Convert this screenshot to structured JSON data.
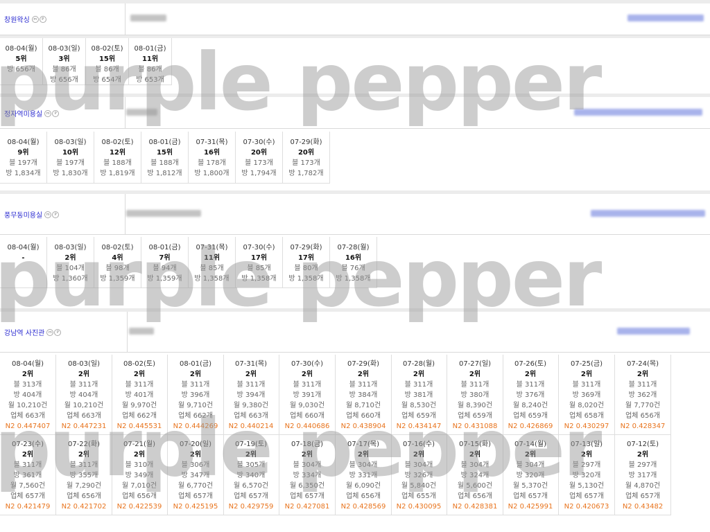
{
  "sections": [
    {
      "name": "창원왁싱",
      "columns": [
        {
          "date": "08-04(월)",
          "rank": "5위",
          "lines": [
            "방 656개"
          ]
        },
        {
          "date": "08-03(일)",
          "rank": "3위",
          "lines": [
            "블 86개",
            "방 656개"
          ]
        },
        {
          "date": "08-02(토)",
          "rank": "15위",
          "lines": [
            "블 86개",
            "방 654개"
          ]
        },
        {
          "date": "08-01(금)",
          "rank": "11위",
          "lines": [
            "블 86개",
            "방 653개"
          ]
        }
      ]
    },
    {
      "name": "정자역미용실",
      "columns": [
        {
          "date": "08-04(월)",
          "rank": "9위",
          "lines": [
            "블 197개",
            "방 1,834개"
          ]
        },
        {
          "date": "08-03(일)",
          "rank": "10위",
          "lines": [
            "블 197개",
            "방 1,830개"
          ]
        },
        {
          "date": "08-02(토)",
          "rank": "12위",
          "lines": [
            "블 188개",
            "방 1,819개"
          ]
        },
        {
          "date": "08-01(금)",
          "rank": "15위",
          "lines": [
            "블 188개",
            "방 1,812개"
          ]
        },
        {
          "date": "07-31(목)",
          "rank": "16위",
          "lines": [
            "블 178개",
            "방 1,800개"
          ]
        },
        {
          "date": "07-30(수)",
          "rank": "20위",
          "lines": [
            "블 173개",
            "방 1,794개"
          ]
        },
        {
          "date": "07-29(화)",
          "rank": "20위",
          "lines": [
            "블 173개",
            "방 1,782개"
          ]
        }
      ]
    },
    {
      "name": "풍무동미용실",
      "columns": [
        {
          "date": "08-04(월)",
          "rank": "-",
          "lines": []
        },
        {
          "date": "08-03(일)",
          "rank": "2위",
          "lines": [
            "블 104개",
            "방 1,360개"
          ]
        },
        {
          "date": "08-02(토)",
          "rank": "4위",
          "lines": [
            "블 98개",
            "방 1,359개"
          ]
        },
        {
          "date": "08-01(금)",
          "rank": "7위",
          "lines": [
            "블 94개",
            "방 1,359개"
          ]
        },
        {
          "date": "07-31(목)",
          "rank": "11위",
          "lines": [
            "블 85개",
            "방 1,358개"
          ]
        },
        {
          "date": "07-30(수)",
          "rank": "17위",
          "lines": [
            "블 85개",
            "방 1,358개"
          ]
        },
        {
          "date": "07-29(화)",
          "rank": "17위",
          "lines": [
            "블 80개",
            "방 1,358개"
          ]
        },
        {
          "date": "07-28(월)",
          "rank": "16위",
          "lines": [
            "블 76개",
            "방 1,358개"
          ]
        }
      ]
    },
    {
      "name": "강남역 사진관",
      "columns": [
        {
          "date": "08-04(월)",
          "rank": "2위",
          "lines": [
            "블 313개",
            "방 404개",
            "월 10,210건",
            "업체 663개"
          ],
          "n2": "N2 0.447407"
        },
        {
          "date": "08-03(일)",
          "rank": "2위",
          "lines": [
            "블 311개",
            "방 404개",
            "월 10,210건",
            "업체 663개"
          ],
          "n2": "N2 0.447231"
        },
        {
          "date": "08-02(토)",
          "rank": "2위",
          "lines": [
            "블 311개",
            "방 401개",
            "월 9,970건",
            "업체 662개"
          ],
          "n2": "N2 0.445531"
        },
        {
          "date": "08-01(금)",
          "rank": "2위",
          "lines": [
            "블 311개",
            "방 396개",
            "월 9,710건",
            "업체 662개"
          ],
          "n2": "N2 0.444269"
        },
        {
          "date": "07-31(목)",
          "rank": "2위",
          "lines": [
            "블 311개",
            "방 394개",
            "월 9,380건",
            "업체 663개"
          ],
          "n2": "N2 0.440214"
        },
        {
          "date": "07-30(수)",
          "rank": "2위",
          "lines": [
            "블 311개",
            "방 391개",
            "월 9,030건",
            "업체 660개"
          ],
          "n2": "N2 0.440686"
        },
        {
          "date": "07-29(화)",
          "rank": "2위",
          "lines": [
            "블 311개",
            "방 384개",
            "월 8,710건",
            "업체 660개"
          ],
          "n2": "N2 0.438904"
        },
        {
          "date": "07-28(월)",
          "rank": "2위",
          "lines": [
            "블 311개",
            "방 381개",
            "월 8,530건",
            "업체 659개"
          ],
          "n2": "N2 0.434147"
        },
        {
          "date": "07-27(일)",
          "rank": "2위",
          "lines": [
            "블 311개",
            "방 380개",
            "월 8,390건",
            "업체 659개"
          ],
          "n2": "N2 0.431088"
        },
        {
          "date": "07-26(토)",
          "rank": "2위",
          "lines": [
            "블 311개",
            "방 376개",
            "월 8,240건",
            "업체 659개"
          ],
          "n2": "N2 0.426869"
        },
        {
          "date": "07-25(금)",
          "rank": "2위",
          "lines": [
            "블 311개",
            "방 369개",
            "월 8,020건",
            "업체 658개"
          ],
          "n2": "N2 0.430297"
        },
        {
          "date": "07-24(목)",
          "rank": "2위",
          "lines": [
            "블 311개",
            "방 362개",
            "월 7,770건",
            "업체 656개"
          ],
          "n2": "N2 0.428347"
        },
        {
          "date": "07-23(수)",
          "rank": "2위",
          "lines": [
            "블 311개",
            "방 361개",
            "월 7,560건",
            "업체 657개"
          ],
          "n2": "N2 0.421479"
        },
        {
          "date": "07-22(화)",
          "rank": "2위",
          "lines": [
            "블 311개",
            "방 355개",
            "월 7,290건",
            "업체 656개"
          ],
          "n2": "N2 0.421702"
        },
        {
          "date": "07-21(월)",
          "rank": "2위",
          "lines": [
            "블 310개",
            "방 349개",
            "월 7,010건",
            "업체 656개"
          ],
          "n2": "N2 0.422539"
        },
        {
          "date": "07-20(일)",
          "rank": "2위",
          "lines": [
            "블 306개",
            "방 347개",
            "월 6,770건",
            "업체 657개"
          ],
          "n2": "N2 0.425195"
        },
        {
          "date": "07-19(토)",
          "rank": "2위",
          "lines": [
            "블 305개",
            "방 340개",
            "월 6,570건",
            "업체 657개"
          ],
          "n2": "N2 0.429759"
        },
        {
          "date": "07-18(금)",
          "rank": "2위",
          "lines": [
            "블 304개",
            "방 334개",
            "월 6,350건",
            "업체 657개"
          ],
          "n2": "N2 0.427081"
        },
        {
          "date": "07-17(목)",
          "rank": "2위",
          "lines": [
            "블 304개",
            "방 331개",
            "월 6,090건",
            "업체 656개"
          ],
          "n2": "N2 0.428569"
        },
        {
          "date": "07-16(수)",
          "rank": "2위",
          "lines": [
            "블 304개",
            "방 326개",
            "월 5,840건",
            "업체 655개"
          ],
          "n2": "N2 0.430095"
        },
        {
          "date": "07-15(화)",
          "rank": "2위",
          "lines": [
            "블 304개",
            "방 324개",
            "월 5,600건",
            "업체 656개"
          ],
          "n2": "N2 0.428381"
        },
        {
          "date": "07-14(월)",
          "rank": "2위",
          "lines": [
            "블 304개",
            "방 320개",
            "월 5,370건",
            "업체 657개"
          ],
          "n2": "N2 0.425991"
        },
        {
          "date": "07-13(일)",
          "rank": "2위",
          "lines": [
            "블 297개",
            "방 320개",
            "월 5,130건",
            "업체 657개"
          ],
          "n2": "N2 0.420673"
        },
        {
          "date": "07-12(토)",
          "rank": "2위",
          "lines": [
            "블 297개",
            "방 317개",
            "월 4,870건",
            "업체 657개"
          ],
          "n2": "N2 0.43482"
        }
      ]
    }
  ],
  "watermark": "purple pepper",
  "colors": {
    "keyword_link": "#2a2ad0",
    "n2_value": "#e8731c",
    "border": "#d9d9d9",
    "watermark": "#969696"
  }
}
